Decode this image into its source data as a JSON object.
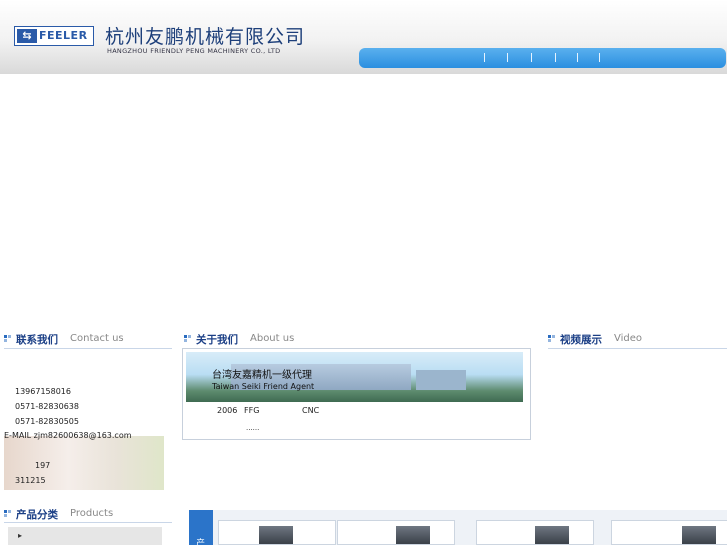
{
  "header": {
    "logo_mark": "⇆",
    "logo_text": "FEELER",
    "company_cn": "杭州友鹏机械有限公司",
    "company_en": "HANGZHOU FRIENDLY PENG MACHINERY CO., LTD",
    "nav_separators": [
      "|",
      "|",
      "|",
      "|",
      "|",
      "|"
    ]
  },
  "contact": {
    "title_cn": "联系我们",
    "title_en": "Contact us",
    "phone1": "13967158016",
    "phone2": "0571-82830638",
    "phone3": "0571-82830505",
    "email": "E-MAIL zjm82600638@163.com",
    "address_no": "197",
    "postcode": "311215"
  },
  "about": {
    "title_cn": "关于我们",
    "title_en": "About us",
    "banner_cn": "台湾友嘉精机一级代理",
    "banner_en": "Taiwan Seiki Friend Agent",
    "line_year": "2006",
    "line_brand": "FFG",
    "line_cnc": "CNC",
    "more": "......"
  },
  "video": {
    "title_cn": "视频展示",
    "title_en": "Video"
  },
  "products": {
    "title_cn": "产品分类",
    "title_en": "Products",
    "tab_label": "产",
    "category_bullet": "▸"
  },
  "colors": {
    "accent": "#2b8fe0",
    "heading": "#1b3f86",
    "brand": "#2a5aa8"
  }
}
